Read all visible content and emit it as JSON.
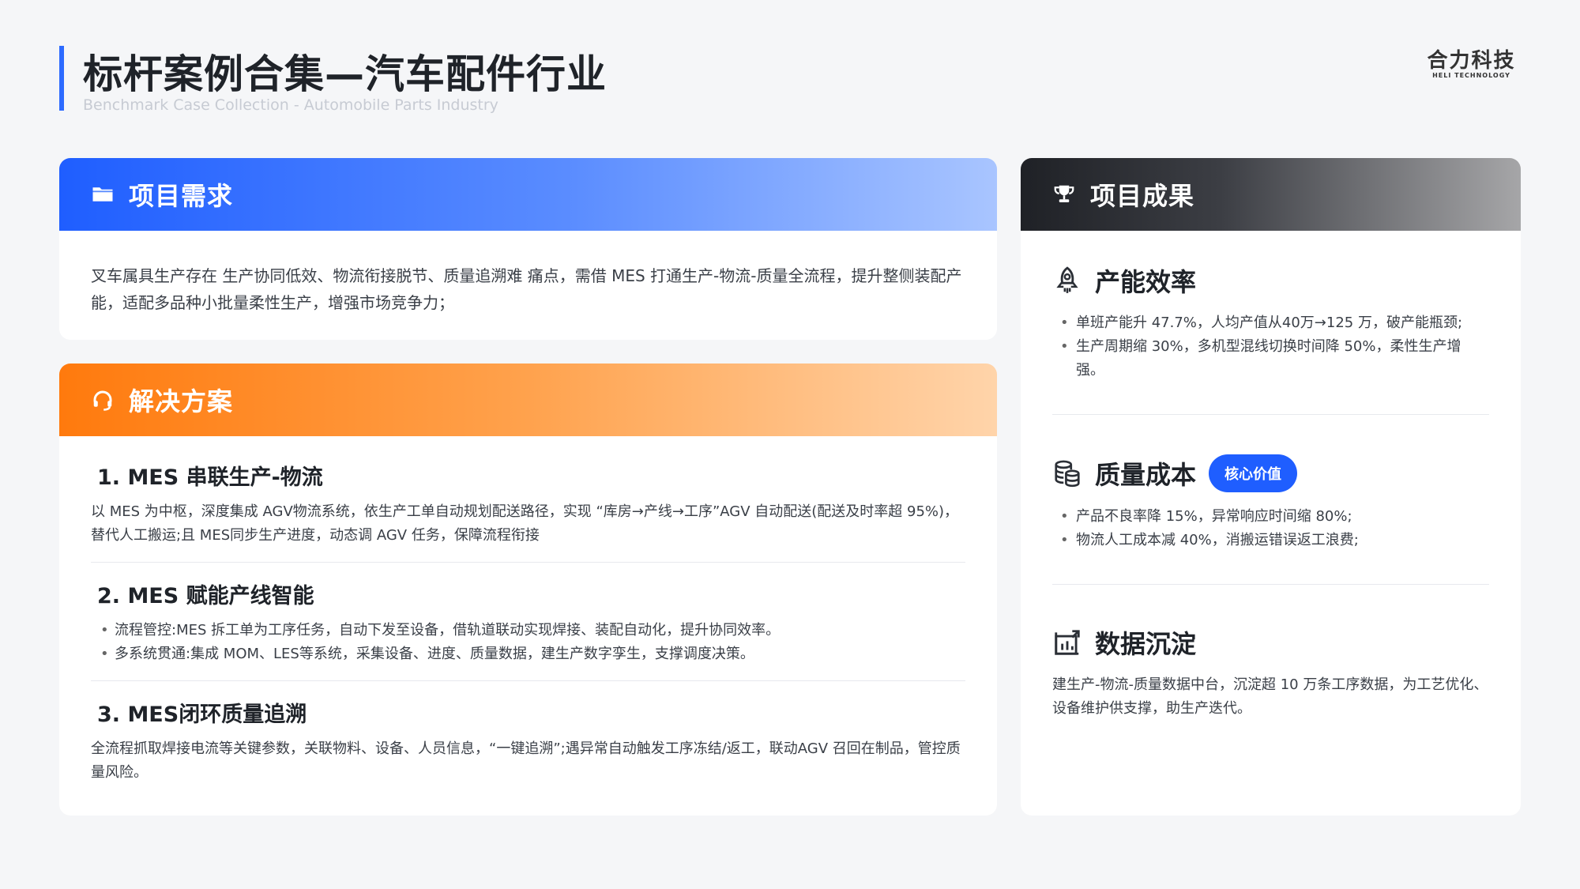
{
  "header": {
    "title": "标杆案例合集—汽车配件行业",
    "subtitle": "Benchmark Case Collection - Automobile Parts Industry",
    "logo_main": "合力科技",
    "logo_sub": "HELI TECHNOLOGY"
  },
  "requirement": {
    "heading": "项目需求",
    "icon": "folder-icon",
    "text": "叉车属具生产存在 生产协同低效、物流衔接脱节、质量追溯难 痛点，需借 MES 打通生产-物流-质量全流程，提升整侧装配产能，适配多品种小批量柔性生产，增强市场竞争力；"
  },
  "solution": {
    "heading": "解决方案",
    "icon": "headset-icon",
    "items": [
      {
        "title": "1. MES 串联生产-物流",
        "text": "以 MES 为中枢，深度集成 AGV物流系统，依生产工单自动规划配送路径，实现 “库房→产线→工序”AGV 自动配送(配送及时率超 95%)，替代人工搬运;且 MES同步生产进度，动态调 AGV 任务，保障流程衔接"
      },
      {
        "title": "2. MES 赋能产线智能",
        "bullets": [
          "流程管控:MES 拆工单为工序任务，自动下发至设备，借轨道联动实现焊接、装配自动化，提升协同效率。",
          "多系统贯通:集成 MOM、LES等系统，采集设备、进度、质量数据，建生产数字孪生，支撑调度决策。"
        ]
      },
      {
        "title": "3. MES闭环质量追溯",
        "text": "全流程抓取焊接电流等关键参数，关联物料、设备、人员信息，“一键追溯”;遇异常自动触发工序冻结/返工，联动AGV 召回在制品，管控质量风险。"
      }
    ]
  },
  "results": {
    "heading": "项目成果",
    "icon": "trophy-icon",
    "items": [
      {
        "title": "产能效率",
        "icon": "rocket-icon",
        "bullets": [
          "单班产能升 47.7%，人均产值从40万→125 万，破产能瓶颈;",
          "生产周期缩 30%，多机型混线切换时间降 50%，柔性生产增强。"
        ]
      },
      {
        "title": "质量成本",
        "icon": "coins-icon",
        "badge": "核心价值",
        "bullets": [
          "产品不良率降 15%，异常响应时间缩 80%;",
          "物流人工成本减 40%，消搬运错误返工浪费;"
        ]
      },
      {
        "title": "数据沉淀",
        "icon": "chart-up-icon",
        "text": "建生产-物流-质量数据中台，沉淀超 10 万条工序数据，为工艺优化、设备维护供支撑，助生产迭代。"
      }
    ]
  },
  "colors": {
    "accent_blue": "#1f5eff",
    "accent_orange": "#ff7a0d",
    "dark": "#1f2126"
  }
}
